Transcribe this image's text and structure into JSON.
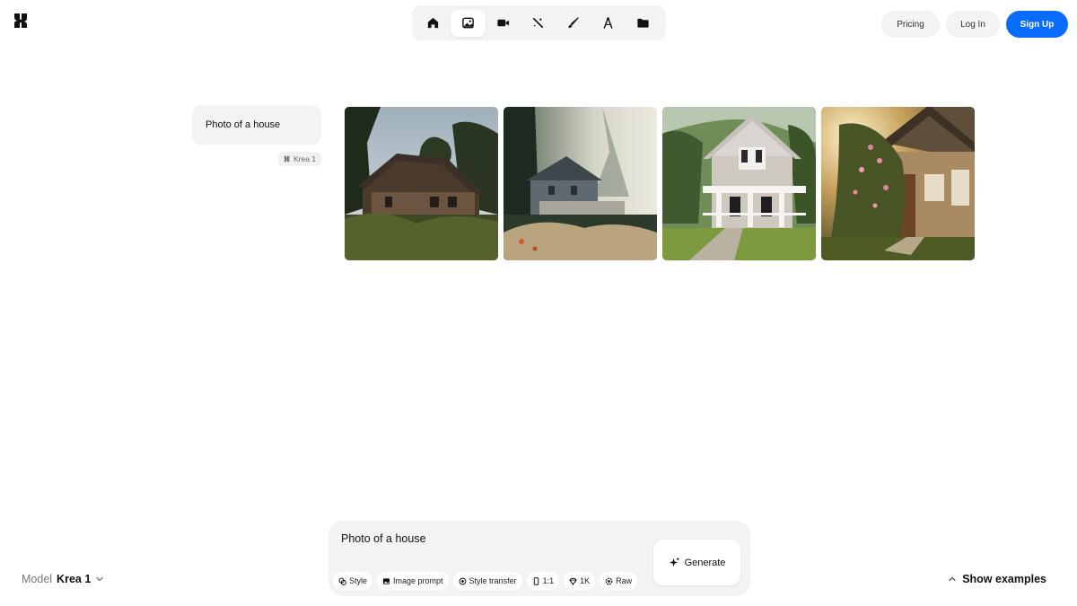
{
  "brand": {
    "logo_icon": "krea-logo-icon"
  },
  "nav": {
    "items": [
      {
        "icon": "home-icon",
        "active": false
      },
      {
        "icon": "image-icon",
        "active": true
      },
      {
        "icon": "video-camera-icon",
        "active": false
      },
      {
        "icon": "magic-wand-icon",
        "active": false
      },
      {
        "icon": "brush-icon",
        "active": false
      },
      {
        "icon": "compass-icon",
        "active": false
      },
      {
        "icon": "folder-icon",
        "active": false
      }
    ]
  },
  "header": {
    "pricing_label": "Pricing",
    "login_label": "Log In",
    "signup_label": "Sign Up",
    "accent_color": "#0a6cff"
  },
  "history": {
    "prompt": "Photo of a house",
    "model_tag": "Krea 1",
    "images": [
      {
        "alt": "house-1"
      },
      {
        "alt": "house-2"
      },
      {
        "alt": "house-3"
      },
      {
        "alt": "house-4"
      }
    ]
  },
  "composer": {
    "prompt_value": "Photo of a house",
    "generate_label": "Generate",
    "chips": [
      {
        "label": "Style",
        "icon": "style-icon"
      },
      {
        "label": "Image prompt",
        "icon": "image-prompt-icon"
      },
      {
        "label": "Style transfer",
        "icon": "style-transfer-icon"
      },
      {
        "label": "1:1",
        "icon": "aspect-ratio-icon"
      },
      {
        "label": "1K",
        "icon": "resolution-icon"
      },
      {
        "label": "Raw",
        "icon": "raw-icon"
      }
    ]
  },
  "footer": {
    "model_label": "Model",
    "model_value": "Krea 1",
    "show_examples_label": "Show examples"
  }
}
